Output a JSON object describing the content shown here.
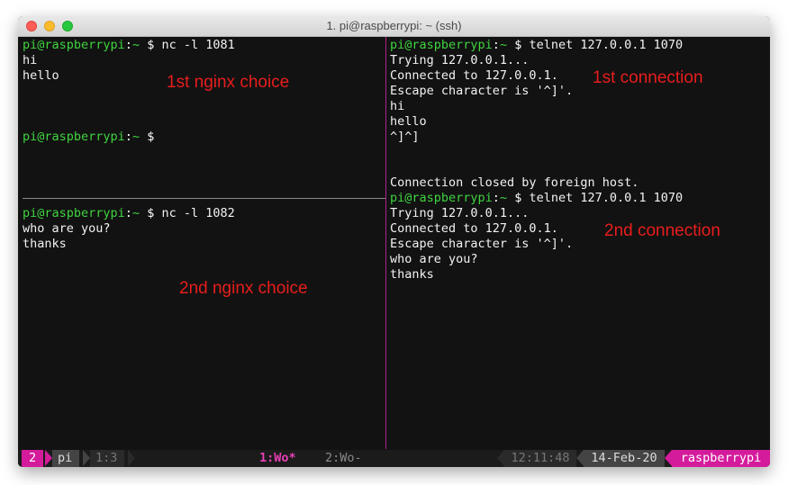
{
  "window": {
    "title": "1. pi@raspberrypi: ~ (ssh)"
  },
  "colors": {
    "prompt_user": "#3fd43f",
    "pane_divider": "#b0208c",
    "annotation": "#e81d1d",
    "tmux_session_bg": "#d41b9c",
    "tmux_host_bg": "#d41b9c"
  },
  "panes": {
    "top_left": {
      "lines": [
        {
          "user": "pi@raspberrypi",
          "sep": ":",
          "path": "~",
          "dollar": " $ ",
          "cmd": "nc -l 1081"
        },
        {
          "text": "hi"
        },
        {
          "text": "hello"
        },
        {
          "text": ""
        },
        {
          "text": ""
        },
        {
          "text": ""
        },
        {
          "user": "pi@raspberrypi",
          "sep": ":",
          "path": "~",
          "dollar": " $ ",
          "cmd": ""
        }
      ]
    },
    "bottom_left": {
      "lines": [
        {
          "user": "pi@raspberrypi",
          "sep": ":",
          "path": "~",
          "dollar": " $ ",
          "cmd": "nc -l 1082"
        },
        {
          "text": "who are you?"
        },
        {
          "text": "thanks"
        }
      ]
    },
    "right": {
      "lines": [
        {
          "user": "pi@raspberrypi",
          "sep": ":",
          "path": "~",
          "dollar": " $ ",
          "cmd": "telnet 127.0.0.1 1070"
        },
        {
          "text": "Trying 127.0.0.1..."
        },
        {
          "text": "Connected to 127.0.0.1."
        },
        {
          "text": "Escape character is '^]'."
        },
        {
          "text": "hi"
        },
        {
          "text": "hello"
        },
        {
          "text": "^]^]"
        },
        {
          "text": ""
        },
        {
          "text": ""
        },
        {
          "text": "Connection closed by foreign host."
        },
        {
          "user": "pi@raspberrypi",
          "sep": ":",
          "path": "~",
          "dollar": " $ ",
          "cmd": "telnet 127.0.0.1 1070"
        },
        {
          "text": "Trying 127.0.0.1..."
        },
        {
          "text": "Connected to 127.0.0.1."
        },
        {
          "text": "Escape character is '^]'."
        },
        {
          "text": "who are you?"
        },
        {
          "text": "thanks"
        }
      ]
    }
  },
  "annotations": {
    "first_nginx": "1st nginx choice",
    "second_nginx": "2nd nginx choice",
    "first_connection": "1st connection",
    "second_connection": "2nd connection"
  },
  "status_bar": {
    "session_index": "2",
    "session_name": "pi",
    "pane_pos": "1:3",
    "window_active": "1:Wo*",
    "window_other": "2:Wo-",
    "time": "12:11:48",
    "date": "14-Feb-20",
    "host": "raspberrypi"
  }
}
